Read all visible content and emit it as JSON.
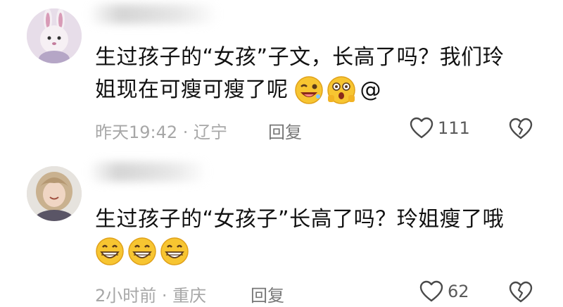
{
  "comments": [
    {
      "line1": "生过孩子的“女孩”子文，长高了吗？我们玲",
      "line2": "姐现在可瘦可瘦了呢",
      "suffix": "@",
      "emojis": [
        "laughing-wink-emoji",
        "shocked-emoji"
      ],
      "time_location": "昨天19:42 · 辽宁",
      "reply_label": "回复",
      "likes": "111"
    },
    {
      "line1": "生过孩子的“女孩子”长高了吗？玲姐瘦了哦",
      "line2": "",
      "suffix": "",
      "emojis": [
        "grin-emoji",
        "grin-emoji",
        "grin-emoji"
      ],
      "time_location": "2小时前 · 重庆",
      "reply_label": "回复",
      "likes": "62"
    }
  ],
  "colors": {
    "meta_gray": "#a7a7a7",
    "text": "#111111",
    "emoji_yellow": "#f7c531"
  }
}
